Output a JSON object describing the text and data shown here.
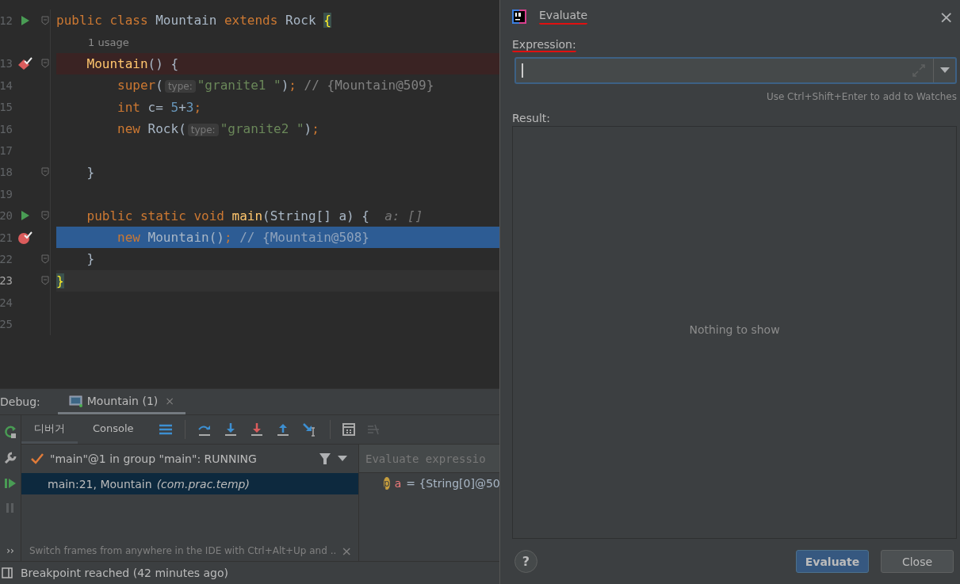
{
  "editor": {
    "lines": [
      {
        "kind": "code",
        "number": "12",
        "runnable": true,
        "breakpoint": false,
        "method_breakpoint": false,
        "execution": false,
        "caret": false,
        "fold": true,
        "tokens": [
          {
            "kind": "keyword",
            "text": "public class "
          },
          {
            "kind": "plain",
            "text": "Mountain "
          },
          {
            "kind": "keyword",
            "text": "extends "
          },
          {
            "kind": "plain",
            "text": "Rock "
          },
          {
            "kind": "brace",
            "text": "{"
          }
        ]
      },
      {
        "kind": "usage",
        "text": "1 usage"
      },
      {
        "kind": "code",
        "number": "13",
        "runnable": false,
        "breakpoint": true,
        "method_breakpoint": true,
        "execution": false,
        "caret": false,
        "fold": true,
        "tokens": [
          {
            "kind": "method",
            "text": "    Mountain"
          },
          {
            "kind": "plain",
            "text": "() {"
          }
        ]
      },
      {
        "kind": "code",
        "number": "14",
        "runnable": false,
        "breakpoint": false,
        "method_breakpoint": false,
        "execution": false,
        "caret": false,
        "fold": false,
        "tokens": [
          {
            "kind": "keyword",
            "text": "        super"
          },
          {
            "kind": "plain",
            "text": "("
          },
          {
            "kind": "hint",
            "text": "type:"
          },
          {
            "kind": "string",
            "text": "\"granite1 \""
          },
          {
            "kind": "plain",
            "text": ")"
          },
          {
            "kind": "keyword",
            "text": ";"
          },
          {
            "kind": "comment",
            "text": " // {Mountain@509}"
          }
        ]
      },
      {
        "kind": "code",
        "number": "15",
        "runnable": false,
        "breakpoint": false,
        "method_breakpoint": false,
        "execution": false,
        "caret": false,
        "fold": false,
        "tokens": [
          {
            "kind": "keyword",
            "text": "        int "
          },
          {
            "kind": "plain",
            "text": "c= "
          },
          {
            "kind": "number",
            "text": "5"
          },
          {
            "kind": "plain",
            "text": "+"
          },
          {
            "kind": "number",
            "text": "3"
          },
          {
            "kind": "keyword",
            "text": ";"
          }
        ]
      },
      {
        "kind": "code",
        "number": "16",
        "runnable": false,
        "breakpoint": false,
        "method_breakpoint": false,
        "execution": false,
        "caret": false,
        "fold": false,
        "tokens": [
          {
            "kind": "keyword",
            "text": "        new "
          },
          {
            "kind": "plain",
            "text": "Rock("
          },
          {
            "kind": "hint",
            "text": "type:"
          },
          {
            "kind": "string",
            "text": "\"granite2 \""
          },
          {
            "kind": "plain",
            "text": ")"
          },
          {
            "kind": "keyword",
            "text": ";"
          }
        ]
      },
      {
        "kind": "code",
        "number": "17",
        "runnable": false,
        "breakpoint": false,
        "method_breakpoint": false,
        "execution": false,
        "caret": false,
        "fold": false
      },
      {
        "kind": "code",
        "number": "18",
        "runnable": false,
        "breakpoint": false,
        "method_breakpoint": false,
        "execution": false,
        "caret": false,
        "fold": true,
        "tokens": [
          {
            "kind": "plain",
            "text": "    }"
          }
        ]
      },
      {
        "kind": "code",
        "number": "19",
        "runnable": false,
        "breakpoint": false,
        "method_breakpoint": false,
        "execution": false,
        "caret": false,
        "fold": false
      },
      {
        "kind": "code",
        "number": "20",
        "runnable": true,
        "breakpoint": false,
        "method_breakpoint": false,
        "execution": false,
        "caret": false,
        "fold": true,
        "tokens": [
          {
            "kind": "keyword",
            "text": "    public static void "
          },
          {
            "kind": "method",
            "text": "main"
          },
          {
            "kind": "plain",
            "text": "(String[] a) {  "
          },
          {
            "kind": "param",
            "text": "a: []"
          }
        ]
      },
      {
        "kind": "code",
        "number": "21",
        "runnable": false,
        "breakpoint": true,
        "method_breakpoint": false,
        "execution": true,
        "caret": false,
        "fold": false,
        "tokens": [
          {
            "kind": "keyword",
            "text": "        new "
          },
          {
            "kind": "plain",
            "text": "Mountain()"
          },
          {
            "kind": "keyword",
            "text": ";"
          },
          {
            "kind": "inline",
            "text": " // {Mountain@508}"
          }
        ]
      },
      {
        "kind": "code",
        "number": "22",
        "runnable": false,
        "breakpoint": false,
        "method_breakpoint": false,
        "execution": false,
        "caret": false,
        "fold": true,
        "tokens": [
          {
            "kind": "plain",
            "text": "    }"
          }
        ]
      },
      {
        "kind": "code",
        "number": "23",
        "runnable": false,
        "breakpoint": false,
        "method_breakpoint": false,
        "execution": false,
        "caret": true,
        "fold": true,
        "tokens": [
          {
            "kind": "brace",
            "text": "}"
          }
        ]
      },
      {
        "kind": "code",
        "number": "24",
        "runnable": false,
        "breakpoint": false,
        "method_breakpoint": false,
        "execution": false,
        "caret": false,
        "fold": false
      },
      {
        "kind": "code",
        "number": "25",
        "runnable": false,
        "breakpoint": false,
        "method_breakpoint": false,
        "execution": false,
        "caret": false,
        "fold": false
      }
    ]
  },
  "debug": {
    "label": "Debug:",
    "session_tab": {
      "label": "Mountain (1)",
      "close": "×"
    },
    "tabs": [
      {
        "label": "디버거",
        "selected": true
      },
      {
        "label": "Console",
        "selected": false
      }
    ],
    "more": "››",
    "thread": "\"main\"@1 in group \"main\": RUNNING",
    "frames": [
      {
        "method": "main:21, Mountain",
        "package": "(com.prac.temp)",
        "selected": true
      }
    ],
    "hint": "Switch frames from anywhere in the IDE with Ctrl+Alt+Up and ..",
    "hint_close": "×",
    "evaluate_placeholder": "Evaluate expressio",
    "variables": [
      {
        "badge": "p",
        "name": "a",
        "value": "= {String[0]@50"
      }
    ]
  },
  "status_bar": "Breakpoint reached (42 minutes ago)",
  "dialog": {
    "title": "Evaluate",
    "title_marked": true,
    "close": "×",
    "expression_label": "Expression:",
    "expression_marked": true,
    "watch_hint": "Use Ctrl+Shift+Enter to add to Watches",
    "result_label": "Result:",
    "result_empty": "Nothing to show",
    "help": "?",
    "buttons": [
      {
        "label": "Evaluate",
        "kind": "primary"
      },
      {
        "label": "Close",
        "kind": "secondary"
      }
    ]
  }
}
